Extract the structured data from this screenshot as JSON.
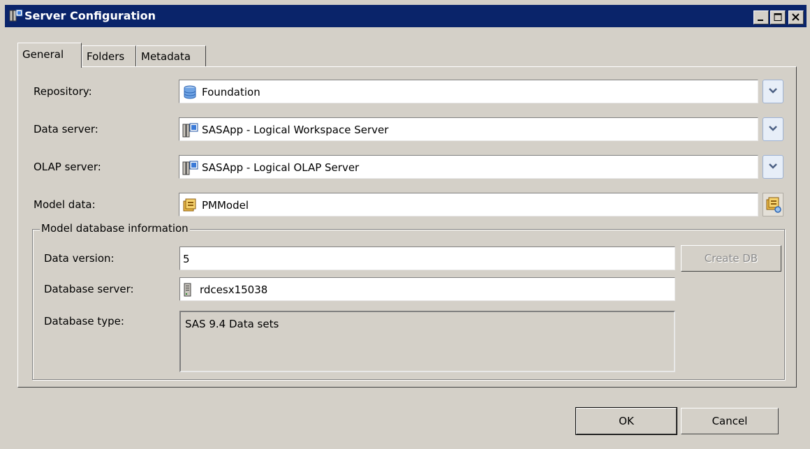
{
  "window": {
    "title": "Server Configuration",
    "icon": "server-config-icon",
    "controls": [
      "minimize-icon",
      "maximize-icon",
      "close-icon"
    ]
  },
  "tabs": [
    {
      "label": "General",
      "active": true
    },
    {
      "label": "Folders",
      "active": false
    },
    {
      "label": "Metadata",
      "active": false
    }
  ],
  "form": {
    "repository": {
      "label": "Repository:",
      "value": "Foundation",
      "icon": "database-icon"
    },
    "data_server": {
      "label": "Data server:",
      "value": "SASApp - Logical Workspace Server",
      "icon": "server-icon"
    },
    "olap_server": {
      "label": "OLAP server:",
      "value": "SASApp - Logical OLAP Server",
      "icon": "server-icon"
    },
    "model_data": {
      "label": "Model data:",
      "value": "PMModel",
      "icon": "model-icon"
    }
  },
  "model_db": {
    "legend": "Model database information",
    "data_version": {
      "label": "Data version:",
      "value": "5"
    },
    "database_server": {
      "label": "Database server:",
      "value": "rdcesx15038",
      "icon": "server-tower-icon"
    },
    "database_type": {
      "label": "Database type:",
      "value": "SAS 9.4 Data sets"
    },
    "create_db_label": "Create DB"
  },
  "buttons": {
    "ok_label": "OK",
    "cancel_label": "Cancel"
  },
  "colors": {
    "title_bar": "#0a246a",
    "dialog_bg": "#d4d0c8",
    "dropdown_arrow": "#4d6185"
  }
}
